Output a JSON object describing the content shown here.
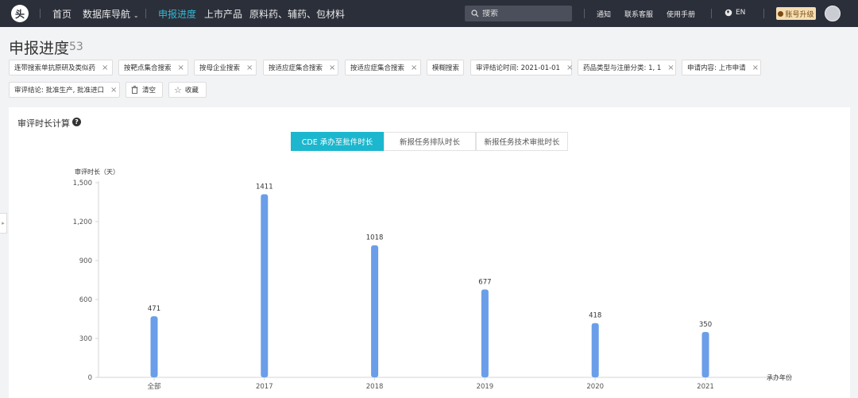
{
  "nav": {
    "logo_text": "头",
    "home": "首页",
    "database": "数据库导航",
    "progress": "申报进度",
    "market": "上市产品",
    "materials": "原料药、辅药、包材料",
    "search_placeholder": "搜索",
    "notice": "通知",
    "support": "联系客服",
    "manual": "使用手册",
    "lang": "EN",
    "upgrade": "账号升级"
  },
  "page": {
    "title": "申报进度",
    "count": "53"
  },
  "filters": [
    {
      "label": "连带搜索单抗原研及类似药",
      "closable": true
    },
    {
      "label": "按靶点集合搜索",
      "closable": true
    },
    {
      "label": "按母企业搜索",
      "closable": true
    },
    {
      "label": "按适应症集合搜索",
      "closable": true
    },
    {
      "label": "按适应症集合搜索",
      "closable": true
    },
    {
      "label": "模糊搜索",
      "closable": false
    },
    {
      "label": "审评结论时间: 2021-01-01",
      "closable": true
    },
    {
      "label": "药品类型与注册分类: 1, 1",
      "closable": true
    },
    {
      "label": "申请内容: 上市申请",
      "closable": true
    },
    {
      "label": "审评结论: 批准生产, 批准进口",
      "closable": true
    }
  ],
  "actions": {
    "clear": "清空",
    "favorite": "收藏"
  },
  "card": {
    "title": "审评时长计算",
    "tabs": [
      "CDE 承办至批件时长",
      "新报任务排队时长",
      "新报任务技术审批时长"
    ],
    "active_tab": 0
  },
  "chart_data": {
    "type": "bar",
    "categories": [
      "全部",
      "2017",
      "2018",
      "2019",
      "2020",
      "2021"
    ],
    "values": [
      471,
      1411,
      1018,
      677,
      418,
      350
    ],
    "data_labels": [
      "471",
      "1411",
      "1018",
      "677",
      "418",
      "350"
    ],
    "ylabel": "审评时长（天）",
    "xlabel": "承办年份",
    "ylim": [
      0,
      1500
    ],
    "yticks": [
      0,
      300,
      600,
      900,
      1200,
      1500
    ],
    "ytick_labels": [
      "0",
      "300",
      "600",
      "900",
      "1,200",
      "1,500"
    ],
    "bar_color": "#6a9ee8",
    "grid": false
  }
}
